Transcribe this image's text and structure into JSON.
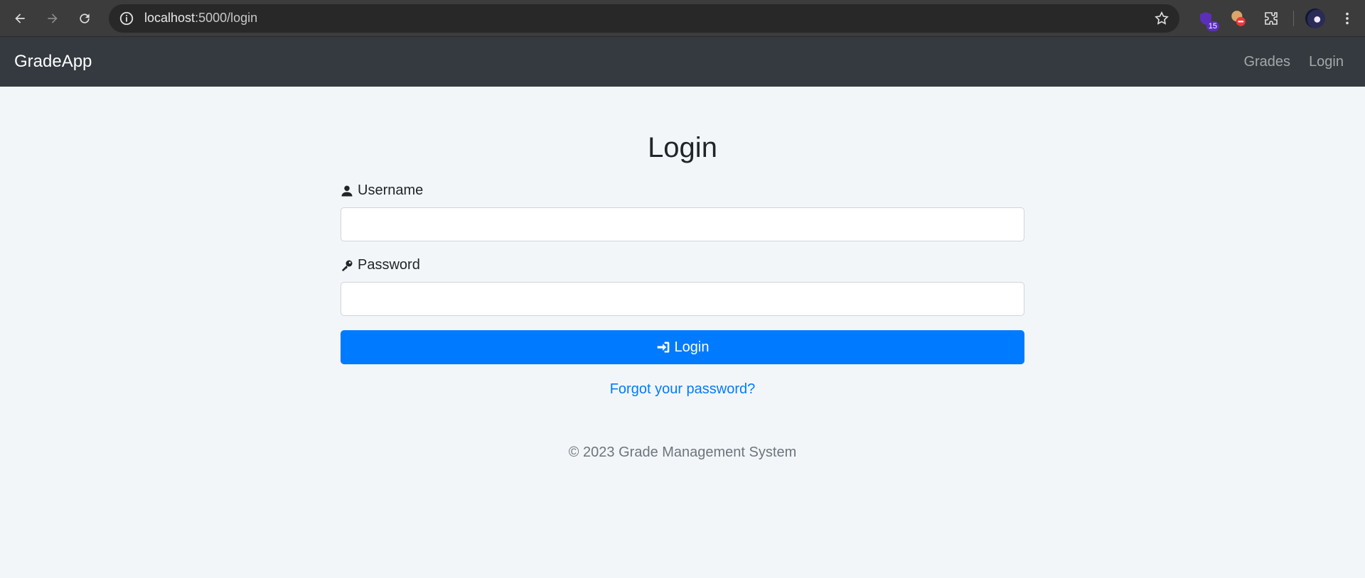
{
  "browser": {
    "url_host": "localhost",
    "url_path": ":5000/login",
    "extension_badge": "15"
  },
  "navbar": {
    "brand": "GradeApp",
    "links": [
      {
        "label": "Grades"
      },
      {
        "label": "Login"
      }
    ]
  },
  "login": {
    "title": "Login",
    "username_label": "Username",
    "username_value": "",
    "password_label": "Password",
    "password_value": "",
    "submit_label": "Login",
    "forgot_link": "Forgot your password?"
  },
  "footer": {
    "text": "© 2023 Grade Management System"
  },
  "colors": {
    "primary": "#007bff",
    "navbar": "#343a40",
    "background": "#f3f6f9"
  }
}
